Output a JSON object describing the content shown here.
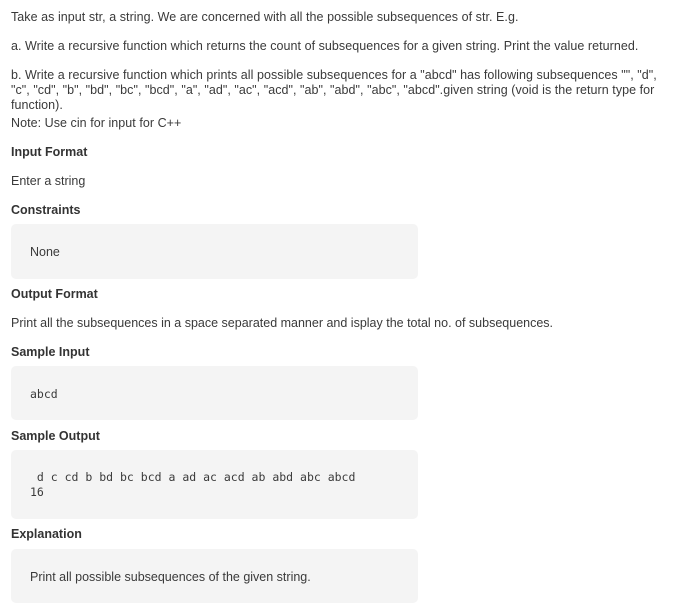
{
  "problem": {
    "intro": "Take as input str, a string. We are concerned with all the possible subsequences of str. E.g.",
    "part_a": "a. Write a recursive function which returns the count of subsequences for a given string. Print the value returned.",
    "part_b": "b. Write a recursive function which prints all possible subsequences for a \"abcd\" has following subsequences \"\", \"d\", \"c\", \"cd\", \"b\", \"bd\", \"bc\", \"bcd\", \"a\", \"ad\", \"ac\", \"acd\", \"ab\", \"abd\", \"abc\", \"abcd\".given string (void is the return type for function).",
    "note": "Note: Use cin for input for C++"
  },
  "input_format": {
    "heading": "Input Format",
    "text": "Enter a string"
  },
  "constraints": {
    "heading": "Constraints",
    "text": "None"
  },
  "output_format": {
    "heading": "Output Format",
    "text": "Print all the subsequences in a space separated manner and isplay the total no. of subsequences."
  },
  "sample_input": {
    "heading": "Sample Input",
    "text": "abcd"
  },
  "sample_output": {
    "heading": "Sample Output",
    "line1": " d c cd b bd bc bcd a ad ac acd ab abd abc abcd",
    "line2": "16"
  },
  "explanation": {
    "heading": "Explanation",
    "text": "Print all possible subsequences of the given string."
  }
}
